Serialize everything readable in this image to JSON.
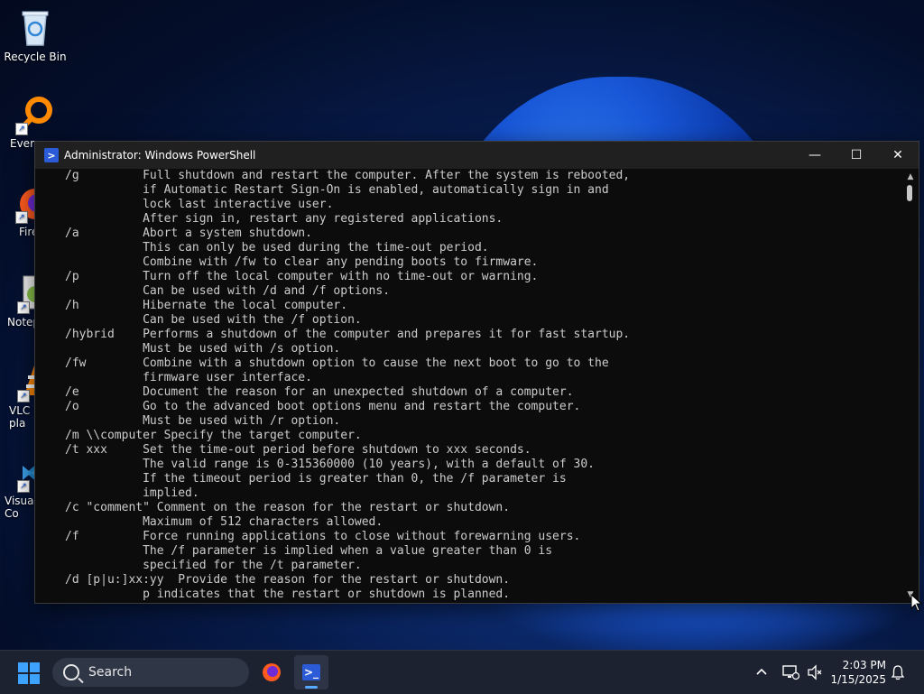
{
  "desktop": {
    "icons": [
      {
        "label": "Recycle Bin"
      },
      {
        "label": "Every"
      },
      {
        "label": "Fire"
      },
      {
        "label": "Notep"
      },
      {
        "label": "VLC r\npla"
      },
      {
        "label": "Visual\nCo"
      }
    ]
  },
  "window": {
    "title": "Administrator: Windows PowerShell",
    "controls": {
      "minimize": "—",
      "maximize": "☐",
      "close": "✕"
    },
    "console_lines": [
      "/g         Full shutdown and restart the computer. After the system is rebooted,",
      "           if Automatic Restart Sign-On is enabled, automatically sign in and",
      "           lock last interactive user.",
      "           After sign in, restart any registered applications.",
      "/a         Abort a system shutdown.",
      "           This can only be used during the time-out period.",
      "           Combine with /fw to clear any pending boots to firmware.",
      "/p         Turn off the local computer with no time-out or warning.",
      "           Can be used with /d and /f options.",
      "/h         Hibernate the local computer.",
      "           Can be used with the /f option.",
      "/hybrid    Performs a shutdown of the computer and prepares it for fast startup.",
      "           Must be used with /s option.",
      "/fw        Combine with a shutdown option to cause the next boot to go to the",
      "           firmware user interface.",
      "/e         Document the reason for an unexpected shutdown of a computer.",
      "/o         Go to the advanced boot options menu and restart the computer.",
      "           Must be used with /r option.",
      "/m \\\\computer Specify the target computer.",
      "/t xxx     Set the time-out period before shutdown to xxx seconds.",
      "           The valid range is 0-315360000 (10 years), with a default of 30.",
      "           If the timeout period is greater than 0, the /f parameter is",
      "           implied.",
      "/c \"comment\" Comment on the reason for the restart or shutdown.",
      "           Maximum of 512 characters allowed.",
      "/f         Force running applications to close without forewarning users.",
      "           The /f parameter is implied when a value greater than 0 is",
      "           specified for the /t parameter.",
      "/d [p|u:]xx:yy  Provide the reason for the restart or shutdown.",
      "           p indicates that the restart or shutdown is planned."
    ]
  },
  "taskbar": {
    "search_placeholder": "Search",
    "clock": {
      "time": "2:03 PM",
      "date": "1/15/2025"
    }
  },
  "colors": {
    "console_bg": "#0c0c0c",
    "console_fg": "#cccccc",
    "titlebar_bg": "#202020",
    "taskbar_bg": "#1c2230",
    "accent": "#3ea3ff"
  }
}
